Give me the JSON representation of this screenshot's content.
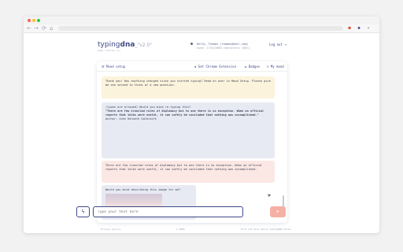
{
  "browser": {
    "nav": {
      "back": "←",
      "forward": "→",
      "reload": "⟳",
      "home": "⌂"
    },
    "ext_icons": [
      {
        "name": "pin-icon",
        "glyph": "●",
        "color": "#e74c3c"
      },
      {
        "name": "shield-icon",
        "glyph": "◆",
        "color": "#404a86"
      },
      {
        "name": "puzzle-icon",
        "glyph": "✦",
        "color": "#7f8db0"
      }
    ]
  },
  "app": {
    "logo_prefix": "typing",
    "logo_bold": "dna",
    "logo_version": "_\"v2.0\"",
    "tagline": "keep records (c)",
    "user_greeting": "Hello, Thomas (thomas@mail.com)",
    "chars_used": "Used: 1724/2000 characters (86%)",
    "logout": "Log out ⇥"
  },
  "panel": {
    "mood_setup": "Mood setup",
    "get_extension": "Get Chrome Extension",
    "badges": "Badges",
    "my_mood": "My mood"
  },
  "messages": {
    "m1": "Thank you! Has anything changed since you started typing? Read on over in Mood Setup. Please give me one second to think of a new question.",
    "m2_intro": "(typos are allowed) Would you mind re-typing this?",
    "m2_quote": "\"There are few ironclad rules of diplomacy but to one there is no exception. When an official reports that talks were useful, it can safely be concluded that nothing was accomplished.\"",
    "m2_author": "Author: John Kenneth Galbraith",
    "m3": "There are few ironclad rules of diplomacy but to one there is no exception. When an official reports that talks were useful, it can safely be concluded that nothing was accomplished.",
    "m4": "Would you mind describing this image for me?"
  },
  "input": {
    "placeholder": "Type your text here",
    "lightning": "ϟ",
    "send": "➤"
  },
  "footer": {
    "privacy": "Privacy policy",
    "center": "© TDNA",
    "right": "Find out more about TypingDNA Focus"
  },
  "colors": {
    "accent": "#404a86",
    "warn_bg": "#fcf3dc",
    "bot_bg": "#e8eaf3",
    "user_bg": "#fbe7e3",
    "send_bg": "#f5b0a6"
  }
}
